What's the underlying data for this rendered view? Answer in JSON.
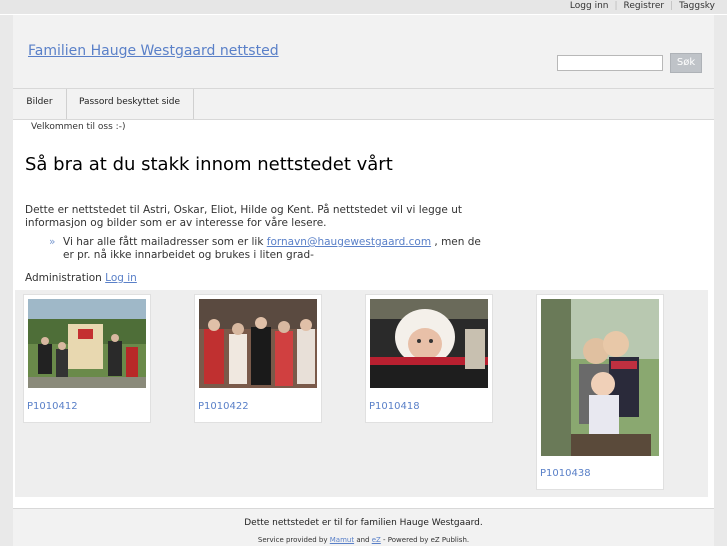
{
  "toplinks": {
    "login": "Logg inn",
    "register": "Registrer",
    "tagcloud": "Taggsky"
  },
  "header": {
    "site_title": "Familien Hauge Westgaard nettsted",
    "search_placeholder": "",
    "search_button": "Søk"
  },
  "nav": {
    "tabs": [
      "Bilder",
      "Passord beskyttet side"
    ]
  },
  "breadcrumb": "Velkommen til oss :-)",
  "main": {
    "heading": "Så bra at du stakk innom nettstedet vårt",
    "intro": "Dette er nettstedet til Astri, Oskar, Eliot, Hilde og Kent. På nettstedet vil vi legge ut informasjon og bilder som er av interesse for våre lesere.",
    "bullet_mark": "»",
    "bullet_before": "Vi har alle fått mailadresser som er lik ",
    "bullet_link": "fornavn@haugewestgaard.com",
    "bullet_after": " , men de er pr. nå ikke innarbeidet og brukes i liten grad-",
    "admin_label": "Administration ",
    "admin_link": "Log in"
  },
  "gallery": [
    {
      "caption": "P1010412"
    },
    {
      "caption": "P1010422"
    },
    {
      "caption": "P1010418"
    },
    {
      "caption": "P1010438"
    }
  ],
  "footer": {
    "text": "Dette nettstedet er til for familien Hauge Westgaard.",
    "service_prefix": "Service provided by ",
    "service_link1": "Mamut",
    "service_and": " and ",
    "service_link2": "eZ",
    "service_suffix": " - Powered by eZ Publish."
  }
}
